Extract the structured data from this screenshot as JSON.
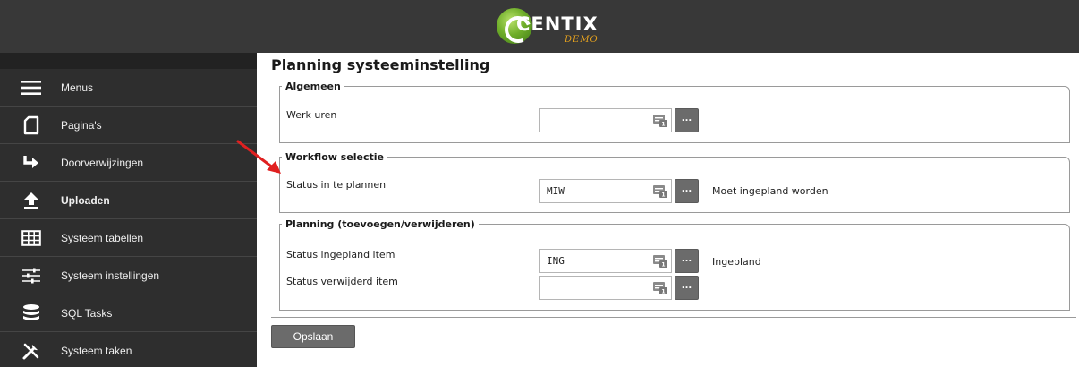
{
  "header": {
    "logo_text": "CENTIX",
    "logo_sub": "DEMO",
    "brand_green": "#6fae2a",
    "brand_orange": "#e6a21e"
  },
  "sidebar": {
    "items": [
      {
        "label": "Menus",
        "icon": "menu-icon",
        "bold": false
      },
      {
        "label": "Pagina's",
        "icon": "page-icon",
        "bold": false
      },
      {
        "label": "Doorverwijzingen",
        "icon": "redirect-arrow-icon",
        "bold": false
      },
      {
        "label": "Uploaden",
        "icon": "upload-icon",
        "bold": true
      },
      {
        "label": "Systeem tabellen",
        "icon": "table-icon",
        "bold": false
      },
      {
        "label": "Systeem instellingen",
        "icon": "sliders-icon",
        "bold": false
      },
      {
        "label": "SQL Tasks",
        "icon": "database-icon",
        "bold": false
      },
      {
        "label": "Systeem taken",
        "icon": "tools-icon",
        "bold": false
      }
    ]
  },
  "main": {
    "title": "Planning systeeminstelling",
    "groups": [
      {
        "legend": "Algemeen",
        "fields": [
          {
            "label": "Werk uren",
            "value": "",
            "description": ""
          }
        ]
      },
      {
        "legend": "Workflow selectie",
        "fields": [
          {
            "label": "Status in te plannen",
            "value": "MIW",
            "description": "Moet ingepland worden"
          }
        ]
      },
      {
        "legend": "Planning (toevoegen/verwijderen)",
        "fields": [
          {
            "label": "Status ingepland item",
            "value": "ING",
            "description": "Ingepland"
          },
          {
            "label": "Status verwijderd item",
            "value": "",
            "description": ""
          }
        ]
      }
    ],
    "lookup_button_label": "...",
    "save_label": "Opslaan"
  },
  "annotation": {
    "arrow_color": "#e02020"
  }
}
